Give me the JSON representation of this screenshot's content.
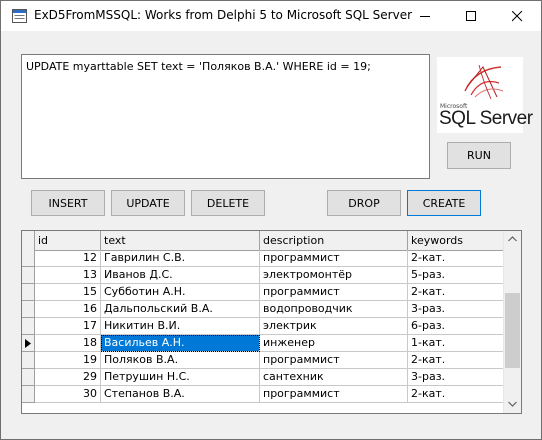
{
  "window": {
    "title": "ExD5FromMSSQL: Works from Delphi 5 to Microsoft SQL Server",
    "controls": [
      "minimize-icon",
      "maximize-icon",
      "close-icon"
    ]
  },
  "editor": {
    "sql": "UPDATE myarttable SET text = 'Поляков В.А.' WHERE id = 19;"
  },
  "logo": {
    "microsoft": "Microsoft",
    "product": "SQL Server"
  },
  "buttons": {
    "run": "RUN",
    "insert": "INSERT",
    "update": "UPDATE",
    "delete": "DELETE",
    "drop": "DROP",
    "create": "CREATE"
  },
  "grid": {
    "columns": [
      "id",
      "text",
      "description",
      "keywords"
    ],
    "rows": [
      {
        "id": "12",
        "text": "Гаврилин С.В.",
        "description": "программист",
        "keywords": "2-кат."
      },
      {
        "id": "13",
        "text": "Иванов Д.С.",
        "description": "электромонтёр",
        "keywords": "5-раз."
      },
      {
        "id": "15",
        "text": "Субботин А.Н.",
        "description": "программист",
        "keywords": "2-кат."
      },
      {
        "id": "16",
        "text": "Дальпольский В.А.",
        "description": "водопроводчик",
        "keywords": "3-раз."
      },
      {
        "id": "17",
        "text": "Никитин В.И.",
        "description": "электрик",
        "keywords": "6-раз."
      },
      {
        "id": "18",
        "text": "Васильев А.Н.",
        "description": "инженер",
        "keywords": "1-кат."
      },
      {
        "id": "19",
        "text": "Поляков В.А.",
        "description": "программист",
        "keywords": "2-кат."
      },
      {
        "id": "29",
        "text": "Петрушин Н.С.",
        "description": "сантехник",
        "keywords": "3-раз."
      },
      {
        "id": "30",
        "text": "Степанов В.А.",
        "description": "программист",
        "keywords": "2-кат."
      }
    ],
    "current_row": 5,
    "selected_cell": "text"
  },
  "colors": {
    "selection": "#0078d7",
    "accent": "#0078d7"
  }
}
